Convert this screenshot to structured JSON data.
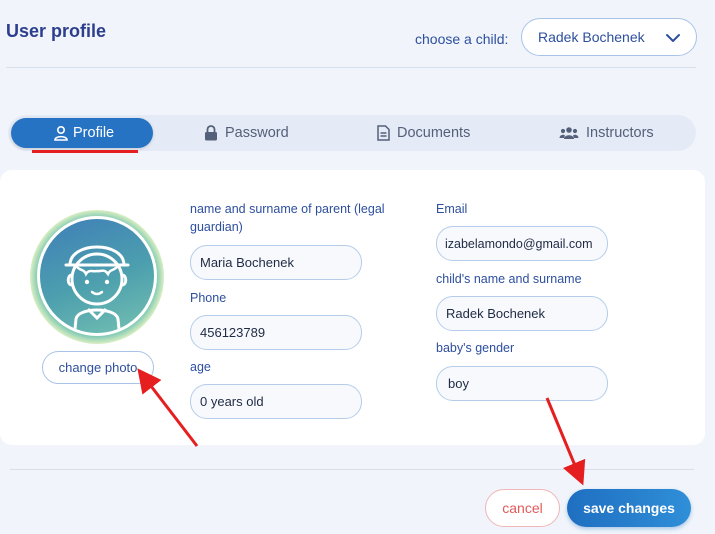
{
  "header": {
    "title": "User profile",
    "child_label": "choose a child:",
    "child_selected": "Radek Bochenek"
  },
  "tabs": [
    {
      "label": "Profile",
      "icon": "user-icon",
      "active": true
    },
    {
      "label": "Password",
      "icon": "lock-icon",
      "active": false
    },
    {
      "label": "Documents",
      "icon": "document-icon",
      "active": false
    },
    {
      "label": "Instructors",
      "icon": "users-icon",
      "active": false
    }
  ],
  "profile": {
    "change_photo_label": "change photo",
    "parent_label": "name and surname of parent (legal guardian)",
    "parent_value": "Maria Bochenek",
    "phone_label": "Phone",
    "phone_value": "456123789",
    "age_label": "age",
    "age_value": "0 years old",
    "email_label": "Email",
    "email_value": "izabelamondo@gmail.com",
    "child_name_label": "child's name and surname",
    "child_name_value": "Radek Bochenek",
    "gender_label": "baby's gender",
    "gender_value": "boy"
  },
  "actions": {
    "cancel_label": "cancel",
    "save_label": "save changes"
  },
  "colors": {
    "accent": "#2673c4",
    "title": "#2d3e8c",
    "annotation": "#e51f1f",
    "cancel": "#e25a5a"
  }
}
